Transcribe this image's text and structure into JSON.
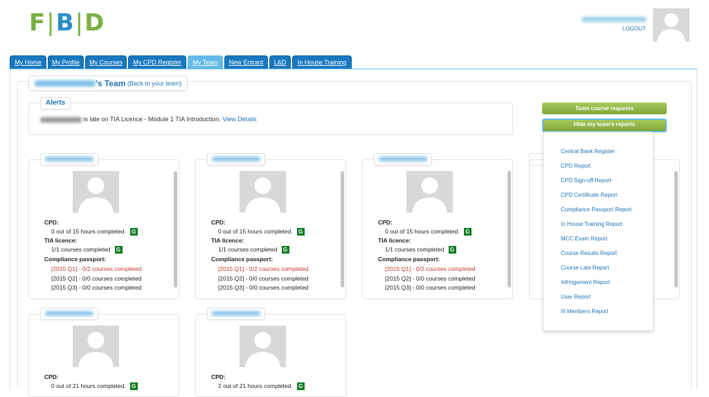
{
  "logo": {
    "f": "F",
    "b": "B",
    "d": "D"
  },
  "header": {
    "logout_label": "LOGOUT"
  },
  "tabs": [
    {
      "label": "My Home"
    },
    {
      "label": "My Profile"
    },
    {
      "label": "My Courses"
    },
    {
      "label": "My CPD Register"
    },
    {
      "label": "My Team"
    },
    {
      "label": "New Entrant"
    },
    {
      "label": "L&D"
    },
    {
      "label": "In House Training"
    }
  ],
  "team": {
    "title_suffix": "'s Team",
    "back_link": "(Back to your team)"
  },
  "alerts": {
    "heading": "Alerts",
    "text": "is late on TIA Licence - Module 1 TIA Introduction.",
    "link": "View Details"
  },
  "actions": {
    "requests": "Team course requests",
    "hide_reports": "Hide my team's reports"
  },
  "reports": [
    "Central Bank Register",
    "CPD Report",
    "CPD Sign-off Report",
    "CPD Certificate Report",
    "Compliance Passport Report",
    "In House Training Report",
    "MCC Exam Report",
    "Course Results Report",
    "Course Late Report",
    "Infringement Report",
    "User Report",
    "III Members Report"
  ],
  "labels": {
    "cpd": "CPD:",
    "tia": "TIA licence:",
    "compliance": "Compliance passport:",
    "badge": "G"
  },
  "members": [
    {
      "cpd": "0 out of 15 hours completed.",
      "tia": "1/1 courses completed",
      "q1": "[2015 Q1] - 0/2 courses completed",
      "q2": "[2015 Q2] - 0/0 courses completed",
      "q3": "[2015 Q3] - 0/0 courses completed"
    },
    {
      "cpd": "0 out of 15 hours completed.",
      "tia": "1/1 courses completed",
      "q1": "[2015 Q1] - 0/2 courses completed",
      "q2": "[2015 Q2] - 0/0 courses completed",
      "q3": "[2015 Q3] - 0/0 courses completed"
    },
    {
      "cpd": "0 out of 15 hours completed.",
      "tia": "1/1 courses completed",
      "q1": "[2015 Q1] - 0/2 courses completed",
      "q2": "[2015 Q2] - 0/0 courses completed",
      "q3": "[2015 Q3] - 0/0 courses completed"
    },
    {
      "cpd": "0 out of 21 hours completed."
    },
    {
      "cpd": "2 out of 21 hours completed."
    }
  ]
}
